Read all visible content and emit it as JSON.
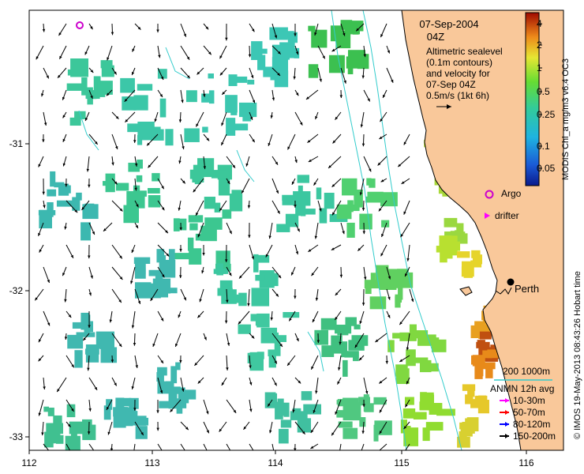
{
  "map": {
    "date": "07-Sep-2004",
    "time": "04Z",
    "description_lines": [
      "Altimetric sealevel",
      "(0.1m contours)",
      "and velocity for",
      "07-Sep 04Z",
      "0.5m/s (1kt 6h)"
    ],
    "city": "Perth",
    "argo_label": "Argo",
    "drifter_label": "drifter",
    "scale_label": "200  1000m",
    "anmn_title": "ANMN 12h avg",
    "anmn_items": [
      {
        "label": "10-30m",
        "color": "#ff00ff"
      },
      {
        "label": "50-70m",
        "color": "#ff0000"
      },
      {
        "label": "80-120m",
        "color": "#0000ff"
      },
      {
        "label": "150-200m",
        "color": "#000000"
      }
    ],
    "colorbar_title": "MODIS Chl_a mg/m3 v6.4 OC3",
    "colorbar_ticks": [
      "4",
      "2",
      "1",
      "0.5",
      "0.25",
      "0.1",
      "0.05"
    ],
    "credit": "© IMOS 19-May-2013 08:43:26 Hobart time",
    "x_ticks": [
      "112",
      "113",
      "114",
      "115",
      "116"
    ],
    "y_ticks": [
      "-31",
      "-32",
      "-33"
    ],
    "colors": {
      "land": "#f9c89a",
      "isobath": "#33cccc",
      "arrow": "#000000",
      "argo": "#cc00cc",
      "drifter": "#ff00ff"
    }
  }
}
